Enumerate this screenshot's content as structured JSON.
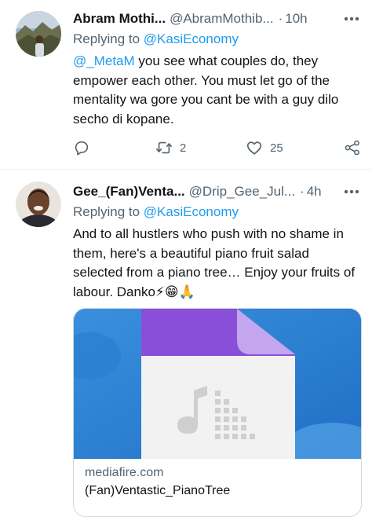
{
  "tweets": [
    {
      "display_name": "Abram Mothi...",
      "handle": "@AbramMothib...",
      "separator": "·",
      "time": "10h",
      "replying_label": "Replying to",
      "replying_to": "@KasiEconomy",
      "mention": "@_MetaM",
      "text": " you see what couples do, they empower each other. You must let go of the mentality wa gore you cant be with a guy dilo secho di kopane.",
      "retweets": "2",
      "likes": "25"
    },
    {
      "display_name": "Gee_(Fan)Venta...",
      "handle": "@Drip_Gee_Jul...",
      "separator": "·",
      "time": "4h",
      "replying_label": "Replying to",
      "replying_to": "@KasiEconomy",
      "text": "And to all hustlers who push with no shame in them, here's a beautiful piano fruit salad selected from a piano tree… Enjoy your fruits of labour. Danko⚡😁🙏",
      "card": {
        "domain": "mediafire.com",
        "title": "(Fan)Ventastic_PianoTree"
      }
    }
  ],
  "icons": {
    "reply": "reply-icon",
    "retweet": "retweet-icon",
    "like": "heart-icon",
    "share": "share-icon",
    "more": "more-icon",
    "file": "audio-file-icon"
  },
  "colors": {
    "link": "#1d9bf0",
    "secondary_text": "#536471",
    "primary_text": "#0f1419",
    "card_background": "#2f7fd3",
    "file_tab": "#8a4fd8"
  }
}
